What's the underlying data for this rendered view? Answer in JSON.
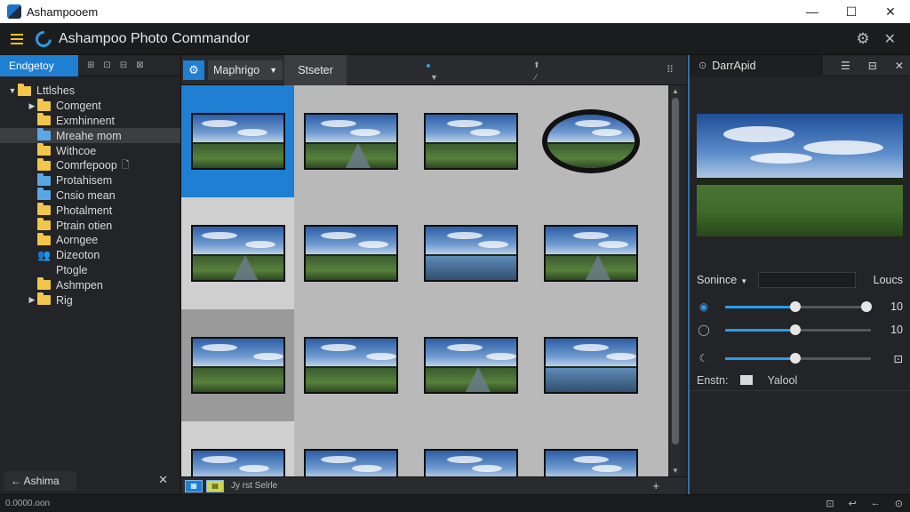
{
  "window": {
    "title": "Ashampooem",
    "minimize": "—",
    "maximize": "☐",
    "close": "✕"
  },
  "app": {
    "title": "Ashampoo Photo Commandor",
    "settings_icon": "gear-icon",
    "close": "✕"
  },
  "left": {
    "tab": "Endgetoy",
    "toolbar_icons": [
      "⊞",
      "⊡",
      "⊟",
      "⊠"
    ],
    "tree": [
      {
        "label": "Lttlshes",
        "caret": "▼",
        "icon": "folder",
        "indent": 0
      },
      {
        "label": "Comgent",
        "caret": "▶",
        "icon": "folder",
        "indent": 1
      },
      {
        "label": "Exmhinnent",
        "caret": "",
        "icon": "folder",
        "indent": 1
      },
      {
        "label": "Mreahe mom",
        "caret": "",
        "icon": "folder-blue",
        "indent": 1,
        "selected": true
      },
      {
        "label": "Withcoe",
        "caret": "",
        "icon": "folder",
        "indent": 1
      },
      {
        "label": "Comrfepoop",
        "caret": "",
        "icon": "folder",
        "indent": 1,
        "doc": true
      },
      {
        "label": "Protahisem",
        "caret": "",
        "icon": "folder-blue",
        "indent": 1
      },
      {
        "label": "Cnsio mean",
        "caret": "",
        "icon": "folder-blue",
        "indent": 1
      },
      {
        "label": "Photalment",
        "caret": "",
        "icon": "folder",
        "indent": 1
      },
      {
        "label": "Ptrain otien",
        "caret": "",
        "icon": "folder",
        "indent": 1
      },
      {
        "label": "Aorngee",
        "caret": "",
        "icon": "folder",
        "indent": 1
      },
      {
        "label": "Dizeoton",
        "caret": "",
        "icon": "person",
        "indent": 1
      },
      {
        "label": "Ptogle",
        "caret": "",
        "icon": "none",
        "indent": 1
      },
      {
        "label": "Ashmpen",
        "caret": "",
        "icon": "folder",
        "indent": 1
      },
      {
        "label": "Rig",
        "caret": "▶",
        "icon": "folder",
        "indent": 1
      }
    ],
    "bottom_button": "← Ashima",
    "bottom_close": "✕"
  },
  "center": {
    "settings_icon": "⚙",
    "dropdown": "Maphrigo",
    "tab": "Stseter",
    "grid_icon": "⠿",
    "bottom_text": "Jy rst Selrle",
    "bottom_plus": "+"
  },
  "right": {
    "tab": "DarrApid",
    "select_label": "Sonince",
    "select_right": "Loucs",
    "sliders": [
      {
        "icon": "◉",
        "value": "10",
        "fill": 0.48,
        "extra_knob": true
      },
      {
        "icon": "◯",
        "value": "10",
        "fill": 0.48
      },
      {
        "icon": "☾",
        "value": "",
        "fill": 0.48,
        "end_icon": "⊡"
      }
    ],
    "info_key": "Enstn:",
    "info_value": "Yalool"
  },
  "status": {
    "text": "0.0000.oon",
    "icons": [
      "⊡",
      "↩",
      "←",
      "⊙"
    ]
  }
}
